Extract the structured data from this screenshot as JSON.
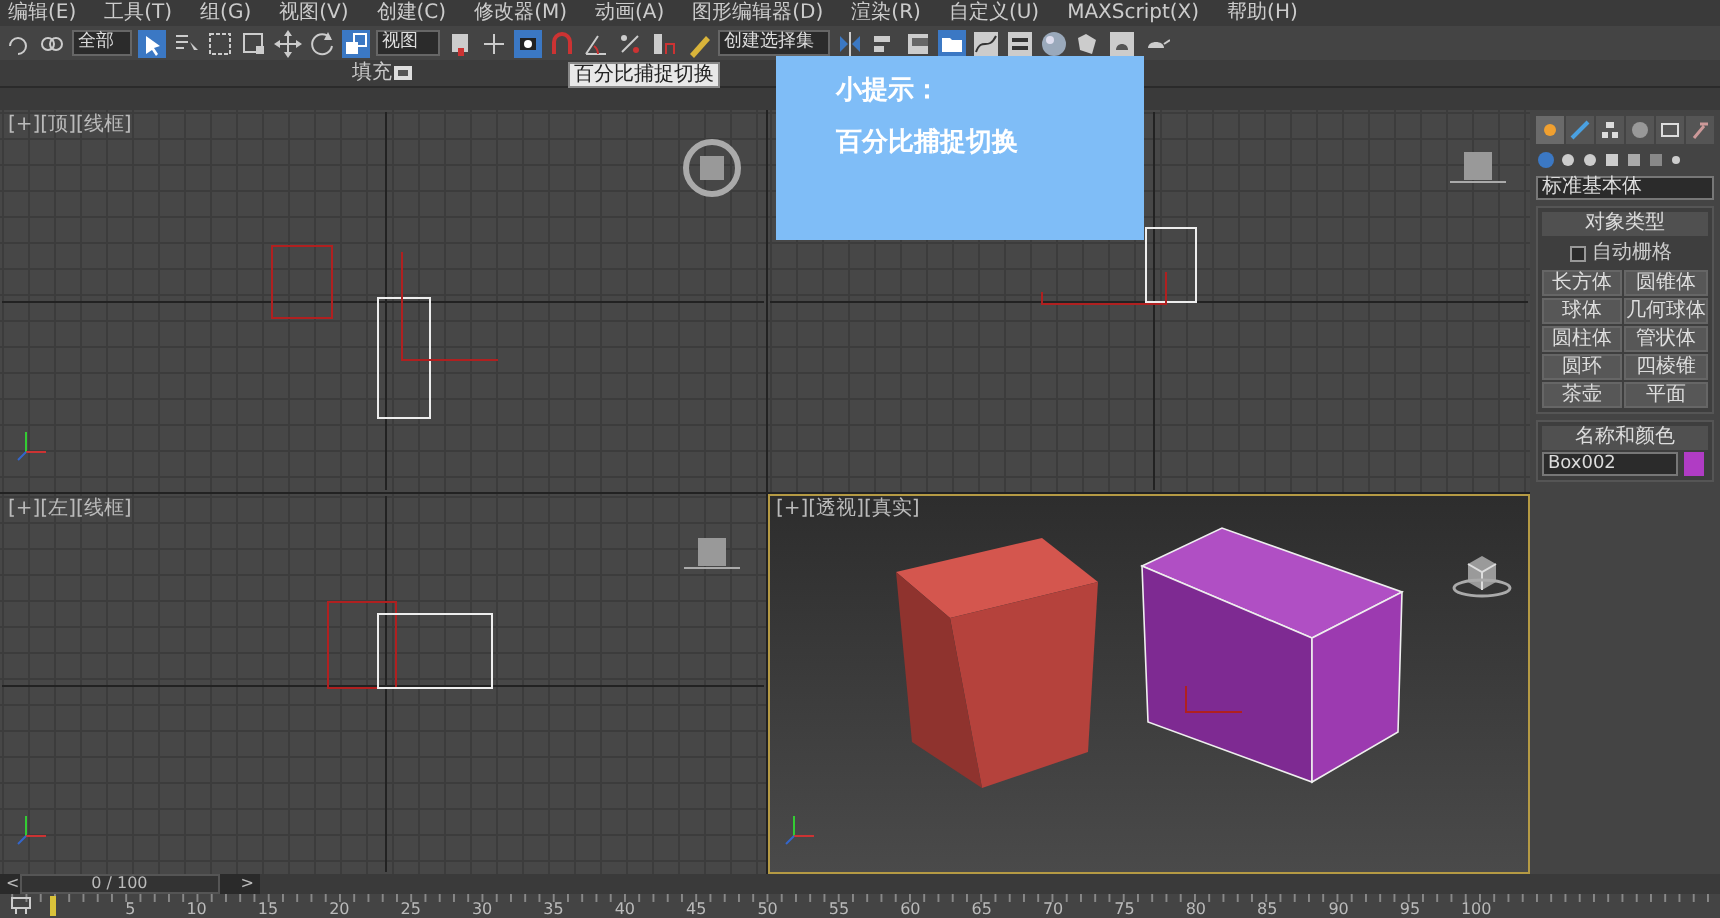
{
  "menu": [
    "编辑(E)",
    "工具(T)",
    "组(G)",
    "视图(V)",
    "创建(C)",
    "修改器(M)",
    "动画(A)",
    "图形编辑器(D)",
    "渲染(R)",
    "自定义(U)",
    "MAXScript(X)",
    "帮助(H)"
  ],
  "toolbar": {
    "selection_filter": "全部",
    "reference_coord": "视图",
    "named_selection": "创建选择集"
  },
  "ribbon": {
    "label": "填充"
  },
  "tooltip": "百分比捕捉切换",
  "tip_overlay": {
    "title": "小提示：",
    "text": "百分比捕捉切换"
  },
  "viewports": [
    {
      "kind": "top",
      "label": "[+][顶][线框]",
      "selected": false
    },
    {
      "kind": "front",
      "selected": false
    },
    {
      "kind": "left",
      "label": "[+][左][线框]",
      "selected": false
    },
    {
      "kind": "perspective",
      "label": "[+][透视][真实]",
      "selected": true
    }
  ],
  "command_panel": {
    "tabs": [
      {
        "selected": true
      },
      {
        "selected": false
      },
      {
        "selected": false
      },
      {
        "selected": false
      },
      {
        "selected": false
      },
      {
        "selected": false
      }
    ],
    "category": "标准基本体",
    "object_type": {
      "title": "对象类型",
      "autogrid": {
        "label": "自动栅格",
        "checked": false
      },
      "buttons": [
        "长方体",
        "圆锥体",
        "球体",
        "几何球体",
        "圆柱体",
        "管状体",
        "圆环",
        "四棱锥",
        "茶壶",
        "平面"
      ]
    },
    "name_color": {
      "title": "名称和颜色",
      "name": "Box002",
      "color": "#b03cc4"
    }
  },
  "timeline": {
    "position": "0 / 100",
    "prev": "<",
    "next": ">",
    "ticks": [
      "5",
      "10",
      "15",
      "20",
      "25",
      "30",
      "35",
      "40",
      "45",
      "50",
      "55",
      "60",
      "65",
      "70",
      "75",
      "80",
      "85",
      "90",
      "95",
      "100"
    ]
  }
}
